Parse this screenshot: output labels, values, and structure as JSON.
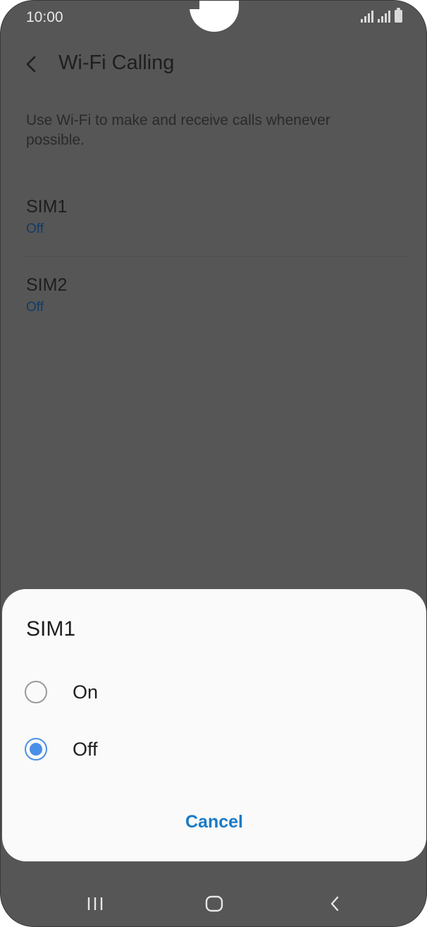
{
  "status_bar": {
    "time": "10:00"
  },
  "app_bar": {
    "title": "Wi-Fi Calling"
  },
  "description": "Use Wi-Fi to make and receive calls whenever possible.",
  "list": [
    {
      "title": "SIM1",
      "value": "Off"
    },
    {
      "title": "SIM2",
      "value": "Off"
    }
  ],
  "dialog": {
    "title": "SIM1",
    "options": [
      {
        "label": "On",
        "selected": false
      },
      {
        "label": "Off",
        "selected": true
      }
    ],
    "cancel_label": "Cancel"
  },
  "colors": {
    "accent": "#4a8fe6",
    "cancel_text": "#1a7ac7",
    "dim_background": "#565656"
  },
  "icons": {
    "back": "chevron-left-icon",
    "recents": "recents-icon",
    "home": "home-icon",
    "nav_back": "nav-back-icon"
  }
}
